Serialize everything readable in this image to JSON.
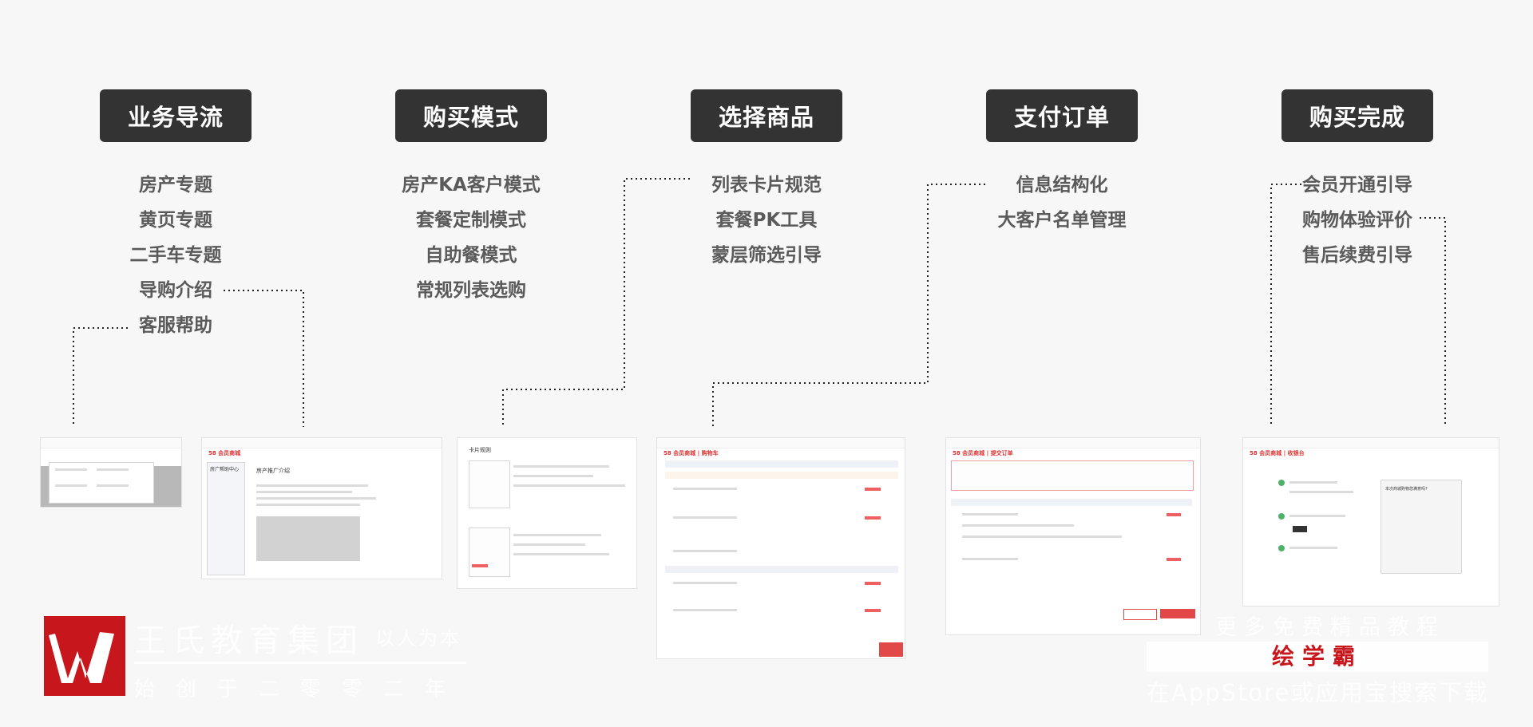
{
  "stages": [
    {
      "title": "业务导流",
      "items": [
        "房产专题",
        "黄页专题",
        "二手车专题",
        "导购介绍",
        "客服帮助"
      ]
    },
    {
      "title": "购买模式",
      "items": [
        "房产KA客户模式",
        "套餐定制模式",
        "自助餐模式",
        "常规列表选购"
      ]
    },
    {
      "title": "选择商品",
      "items": [
        "列表卡片规范",
        "套餐PK工具",
        "蒙层筛选引导"
      ]
    },
    {
      "title": "支付订单",
      "items": [
        "信息结构化",
        "大客户名单管理"
      ]
    },
    {
      "title": "购买完成",
      "items": [
        "会员开通引导",
        "购物体验评价",
        "售后续费引导"
      ]
    }
  ],
  "thumbnails": {
    "help_title": "房产推广介绍",
    "help_sidebar": "房广帮助中心",
    "card_title": "卡片规则",
    "logo": "58 会员商城",
    "select_title": "58 会员商城 | 购物车",
    "order_title": "58 会员商城 | 提交订单",
    "done_title": "58 会员商城 | 收银台",
    "done_prompt": "本次商城购物您满意吗?"
  },
  "watermark": {
    "brand_name": "王氏教育集团",
    "brand_motto": "以人为本",
    "brand_since": "始创于二零零二年",
    "promo_top": "更多免费精品教程",
    "promo_app": "绘学霸",
    "promo_bottom": "在AppStore或应用宝搜索下载"
  }
}
